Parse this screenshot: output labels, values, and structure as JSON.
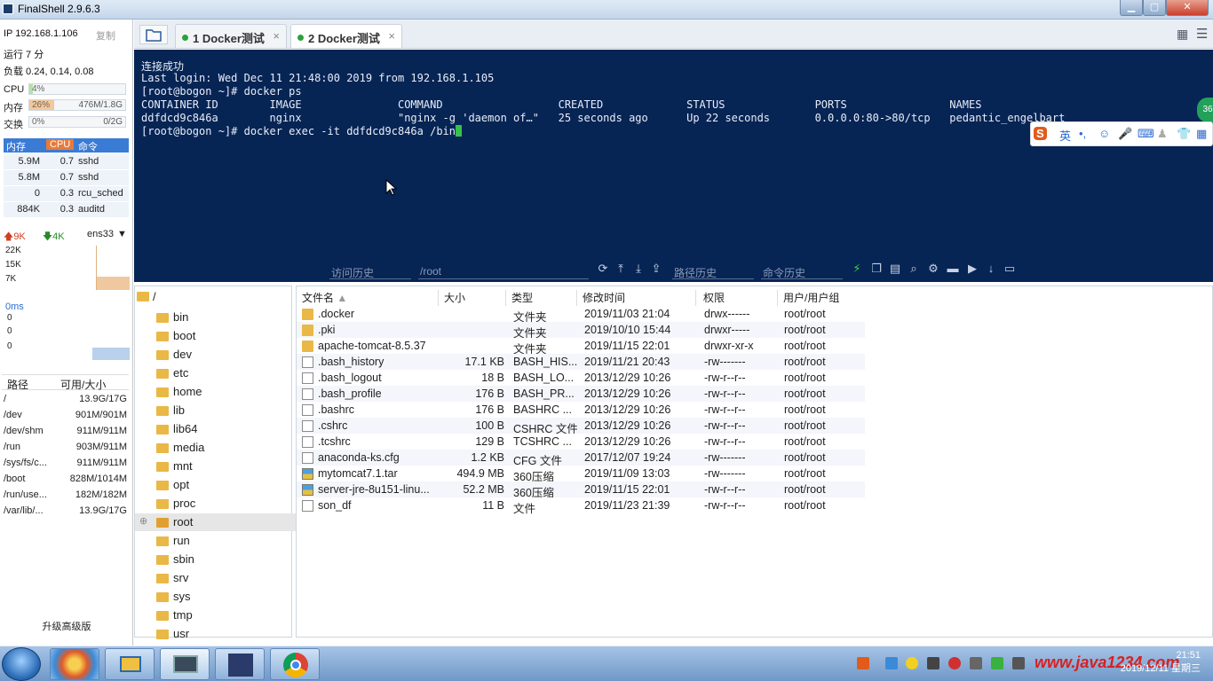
{
  "window": {
    "title": "FinalShell 2.9.6.3"
  },
  "sysinfo": {
    "ip": "IP 192.168.1.106",
    "copy": "复制",
    "uptime": "运行 7 分",
    "load": "负载 0.24, 0.14, 0.08",
    "cpu": {
      "label": "CPU",
      "pct": "4%",
      "level": 0.04
    },
    "mem": {
      "label": "内存",
      "pct": "26%",
      "value": "476M/1.8G",
      "level": 0.26
    },
    "swap": {
      "label": "交换",
      "pct": "0%",
      "value": "0/2G",
      "level": 0
    }
  },
  "processes": {
    "headers": [
      "内存",
      "CPU",
      "命令"
    ],
    "rows": [
      {
        "mem": "5.9M",
        "cpu": "0.7",
        "cmd": "sshd"
      },
      {
        "mem": "5.8M",
        "cpu": "0.7",
        "cmd": "sshd"
      },
      {
        "mem": "0",
        "cpu": "0.3",
        "cmd": "rcu_sched"
      },
      {
        "mem": "884K",
        "cpu": "0.3",
        "cmd": "auditd"
      }
    ]
  },
  "network": {
    "up": "9K",
    "down": "4K",
    "iface": "ens33",
    "scale": [
      "22K",
      "15K",
      "7K"
    ]
  },
  "latency": {
    "label": "0ms",
    "scale": [
      "0",
      "0",
      "0"
    ]
  },
  "disks": {
    "headers": [
      "路径",
      "可用/大小"
    ],
    "rows": [
      {
        "path": "/",
        "size": "13.9G/17G"
      },
      {
        "path": "/dev",
        "size": "901M/901M"
      },
      {
        "path": "/dev/shm",
        "size": "911M/911M"
      },
      {
        "path": "/run",
        "size": "903M/911M"
      },
      {
        "path": "/sys/fs/c...",
        "size": "911M/911M"
      },
      {
        "path": "/boot",
        "size": "828M/1014M"
      },
      {
        "path": "/run/use...",
        "size": "182M/182M"
      },
      {
        "path": "/var/lib/...",
        "size": "13.9G/17G"
      }
    ]
  },
  "upgrade": "升级高级版",
  "tabs": [
    {
      "label": "1 Docker测试",
      "close": "×"
    },
    {
      "label": "2 Docker测试",
      "close": "×"
    }
  ],
  "terminal": {
    "lines": [
      "连接成功",
      "Last login: Wed Dec 11 21:48:00 2019 from 192.168.1.105",
      "[root@bogon ~]# docker ps",
      "CONTAINER ID        IMAGE               COMMAND                  CREATED             STATUS              PORTS                NAMES",
      "ddfdcd9c846a        nginx               \"nginx -g 'daemon of…\"   25 seconds ago      Up 22 seconds       0.0.0.0:80->80/tcp   pedantic_engelbart",
      "[root@bogon ~]# docker exec -it ddfdcd9c846a /bin"
    ]
  },
  "termbar": {
    "history": "访问历史",
    "path": "/root",
    "path_history": "路径历史",
    "cmd_history": "命令历史"
  },
  "ime": {
    "lang": "英",
    "badge": "36"
  },
  "tree": {
    "root": "/",
    "items": [
      "bin",
      "boot",
      "dev",
      "etc",
      "home",
      "lib",
      "lib64",
      "media",
      "mnt",
      "opt",
      "proc",
      "root",
      "run",
      "sbin",
      "srv",
      "sys",
      "tmp",
      "usr"
    ]
  },
  "files": {
    "headers": [
      "文件名",
      "大小",
      "类型",
      "修改时间",
      "权限",
      "用户/用户组"
    ],
    "rows": [
      {
        "name": ".docker",
        "size": "",
        "type": "文件夹",
        "mtime": "2019/11/03 21:04",
        "perm": "drwx------",
        "owner": "root/root",
        "kind": "folder"
      },
      {
        "name": ".pki",
        "size": "",
        "type": "文件夹",
        "mtime": "2019/10/10 15:44",
        "perm": "drwxr-----",
        "owner": "root/root",
        "kind": "folder"
      },
      {
        "name": "apache-tomcat-8.5.37",
        "size": "",
        "type": "文件夹",
        "mtime": "2019/11/15 22:01",
        "perm": "drwxr-xr-x",
        "owner": "root/root",
        "kind": "folder"
      },
      {
        "name": ".bash_history",
        "size": "17.1 KB",
        "type": "BASH_HIS...",
        "mtime": "2019/11/21 20:43",
        "perm": "-rw-------",
        "owner": "root/root",
        "kind": "file"
      },
      {
        "name": ".bash_logout",
        "size": "18 B",
        "type": "BASH_LO...",
        "mtime": "2013/12/29 10:26",
        "perm": "-rw-r--r--",
        "owner": "root/root",
        "kind": "file"
      },
      {
        "name": ".bash_profile",
        "size": "176 B",
        "type": "BASH_PR...",
        "mtime": "2013/12/29 10:26",
        "perm": "-rw-r--r--",
        "owner": "root/root",
        "kind": "file"
      },
      {
        "name": ".bashrc",
        "size": "176 B",
        "type": "BASHRC ...",
        "mtime": "2013/12/29 10:26",
        "perm": "-rw-r--r--",
        "owner": "root/root",
        "kind": "file"
      },
      {
        "name": ".cshrc",
        "size": "100 B",
        "type": "CSHRC 文件",
        "mtime": "2013/12/29 10:26",
        "perm": "-rw-r--r--",
        "owner": "root/root",
        "kind": "file"
      },
      {
        "name": ".tcshrc",
        "size": "129 B",
        "type": "TCSHRC ...",
        "mtime": "2013/12/29 10:26",
        "perm": "-rw-r--r--",
        "owner": "root/root",
        "kind": "file"
      },
      {
        "name": "anaconda-ks.cfg",
        "size": "1.2 KB",
        "type": "CFG 文件",
        "mtime": "2017/12/07 19:24",
        "perm": "-rw-------",
        "owner": "root/root",
        "kind": "file"
      },
      {
        "name": "mytomcat7.1.tar",
        "size": "494.9 MB",
        "type": "360压缩",
        "mtime": "2019/11/09 13:03",
        "perm": "-rw-------",
        "owner": "root/root",
        "kind": "rar"
      },
      {
        "name": "server-jre-8u151-linu...",
        "size": "52.2 MB",
        "type": "360压缩",
        "mtime": "2019/11/15 22:01",
        "perm": "-rw-r--r--",
        "owner": "root/root",
        "kind": "rar"
      },
      {
        "name": "son_df",
        "size": "11 B",
        "type": "文件",
        "mtime": "2019/11/23 21:39",
        "perm": "-rw-r--r--",
        "owner": "root/root",
        "kind": "file"
      }
    ]
  },
  "taskbar": {
    "date": "2019/12/11 星期三",
    "time": "21:51",
    "watermark": "www.java1234.com"
  },
  "colors": {
    "terminal_bg": "#062454",
    "accent": "#3a7bd5",
    "cursor": "#34c24a"
  }
}
